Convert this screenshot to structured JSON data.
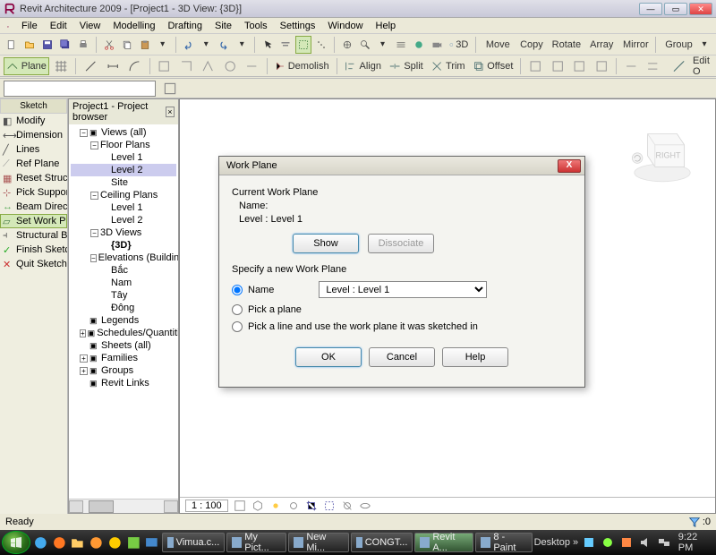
{
  "titlebar": {
    "text": "Revit Architecture 2009 - [Project1 - 3D View: {3D}]"
  },
  "menu": {
    "items": [
      "File",
      "Edit",
      "View",
      "Modelling",
      "Drafting",
      "Site",
      "Tools",
      "Settings",
      "Window",
      "Help"
    ]
  },
  "toolbar1": {
    "labels": {
      "threeD": "3D",
      "move": "Move",
      "copy": "Copy",
      "rotate": "Rotate",
      "array": "Array",
      "mirror": "Mirror",
      "group": "Group"
    }
  },
  "toolbar2": {
    "labels": {
      "plane": "Plane",
      "demolish": "Demolish",
      "align": "Align",
      "split": "Split",
      "trim": "Trim",
      "offset": "Offset",
      "editOpt": "Edit O"
    }
  },
  "options": {
    "title": "Sketch",
    "items": [
      "Modify",
      "Dimension",
      "Lines",
      "Ref Plane",
      "Reset Structura",
      "Pick Supports",
      "Beam Direction",
      "Set Work Plane",
      "Structural Bean",
      "Finish Sketch",
      "Quit Sketch"
    ],
    "selectedIndex": 7
  },
  "browser": {
    "title": "Project1 - Project browser",
    "tree": [
      {
        "level": 0,
        "label": "Views (all)",
        "exp": "-",
        "icon": "eye"
      },
      {
        "level": 1,
        "label": "Floor Plans",
        "exp": "-"
      },
      {
        "level": 2,
        "label": "Level 1"
      },
      {
        "level": 2,
        "label": "Level 2",
        "selected": true
      },
      {
        "level": 2,
        "label": "Site"
      },
      {
        "level": 1,
        "label": "Ceiling Plans",
        "exp": "-"
      },
      {
        "level": 2,
        "label": "Level 1"
      },
      {
        "level": 2,
        "label": "Level 2"
      },
      {
        "level": 1,
        "label": "3D Views",
        "exp": "-"
      },
      {
        "level": 2,
        "label": "{3D}",
        "bold": true
      },
      {
        "level": 1,
        "label": "Elevations (Building",
        "exp": "-"
      },
      {
        "level": 2,
        "label": "Bắc"
      },
      {
        "level": 2,
        "label": "Nam"
      },
      {
        "level": 2,
        "label": "Tây"
      },
      {
        "level": 2,
        "label": "Đông"
      },
      {
        "level": 0,
        "label": "Legends",
        "icon": "legend"
      },
      {
        "level": 0,
        "label": "Schedules/Quantitie",
        "exp": "+",
        "icon": "schedule"
      },
      {
        "level": 0,
        "label": "Sheets (all)",
        "icon": "sheet"
      },
      {
        "level": 0,
        "label": "Families",
        "exp": "+",
        "icon": "family"
      },
      {
        "level": 0,
        "label": "Groups",
        "exp": "+",
        "icon": "group"
      },
      {
        "level": 0,
        "label": "Revit Links",
        "icon": "link"
      }
    ]
  },
  "viewport": {
    "scale": "1 : 100",
    "cube_face": "RIGHT"
  },
  "dialog": {
    "title": "Work Plane",
    "current_label": "Current Work Plane",
    "name_label": "Name:",
    "name_value": "Level : Level 1",
    "show": "Show",
    "dissociate": "Dissociate",
    "specify": "Specify a new Work Plane",
    "opt_name": "Name",
    "opt_pick": "Pick a plane",
    "opt_line": "Pick a line and use the work plane it was sketched in",
    "select_value": "Level : Level 1",
    "ok": "OK",
    "cancel": "Cancel",
    "help": "Help"
  },
  "status": {
    "ready": "Ready",
    "filter": ":0"
  },
  "taskbar": {
    "items": [
      {
        "label": "Vimua.c..."
      },
      {
        "label": "My Pict..."
      },
      {
        "label": "New Mi..."
      },
      {
        "label": "CONGT..."
      },
      {
        "label": "Revit A...",
        "active": true
      },
      {
        "label": "8 - Paint"
      }
    ],
    "desktop": "Desktop",
    "clock": "9:22 PM"
  }
}
